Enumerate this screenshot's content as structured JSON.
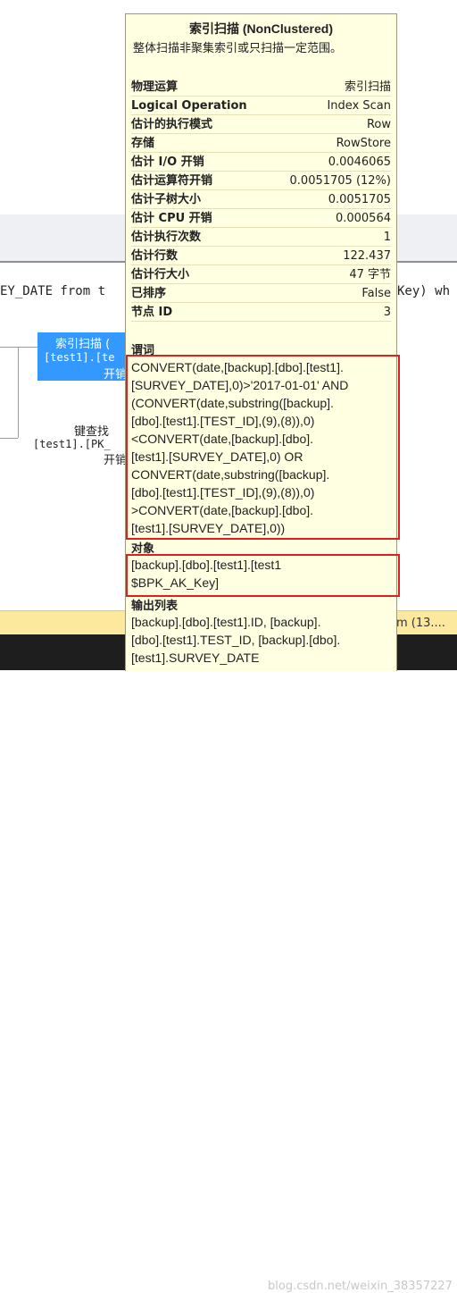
{
  "tooltip": {
    "title": "索引扫描 (NonClustered)",
    "description": "整体扫描非聚集索引或只扫描一定范围。",
    "properties": [
      {
        "key": "物理运算",
        "value": "索引扫描"
      },
      {
        "key": "Logical Operation",
        "value": "Index Scan"
      },
      {
        "key": "估计的执行模式",
        "value": "Row"
      },
      {
        "key": "存储",
        "value": "RowStore"
      },
      {
        "key": "估计 I/O 开销",
        "value": "0.0046065"
      },
      {
        "key": "估计运算符开销",
        "value": "0.0051705 (12%)"
      },
      {
        "key": "估计子树大小",
        "value": "0.0051705"
      },
      {
        "key": "估计 CPU 开销",
        "value": "0.000564"
      },
      {
        "key": "估计执行次数",
        "value": "1"
      },
      {
        "key": "估计行数",
        "value": "122.437"
      },
      {
        "key": "估计行大小",
        "value": "47 字节"
      },
      {
        "key": "已排序",
        "value": "False"
      },
      {
        "key": "节点 ID",
        "value": "3"
      }
    ],
    "predicate_label": "谓词",
    "predicate_lines": [
      "CONVERT(date,[backup].[dbo].[test1].",
      "[SURVEY_DATE],0)>'2017-01-01' AND",
      "(CONVERT(date,substring([backup].",
      "[dbo].[test1].[TEST_ID],(9),(8)),0)",
      "<CONVERT(date,[backup].[dbo].",
      "[test1].[SURVEY_DATE],0) OR",
      "CONVERT(date,substring([backup].",
      "[dbo].[test1].[TEST_ID],(9),(8)),0)",
      ">CONVERT(date,[backup].[dbo].",
      "[test1].[SURVEY_DATE],0))"
    ],
    "object_label": "对象",
    "object_lines": [
      "[backup].[dbo].[test1].[test1",
      "$BPK_AK_Key]"
    ],
    "output_label": "输出列表",
    "output_lines": [
      "[backup].[dbo].[test1].ID, [backup].",
      "[dbo].[test1].TEST_ID, [backup].[dbo].",
      "[test1].SURVEY_DATE"
    ]
  },
  "background": {
    "query_left": "EY_DATE from t",
    "query_right": "Key) wh",
    "node_selected": {
      "name": "索引扫描 (",
      "table": "[test1].[te",
      "cost": "开销"
    },
    "node_key_lookup": {
      "name": "键查找",
      "table": "[test1].[PK_",
      "cost": "开销"
    },
    "status_text": "om (13....",
    "watermark": "blog.csdn.net/weixin_38357227"
  }
}
